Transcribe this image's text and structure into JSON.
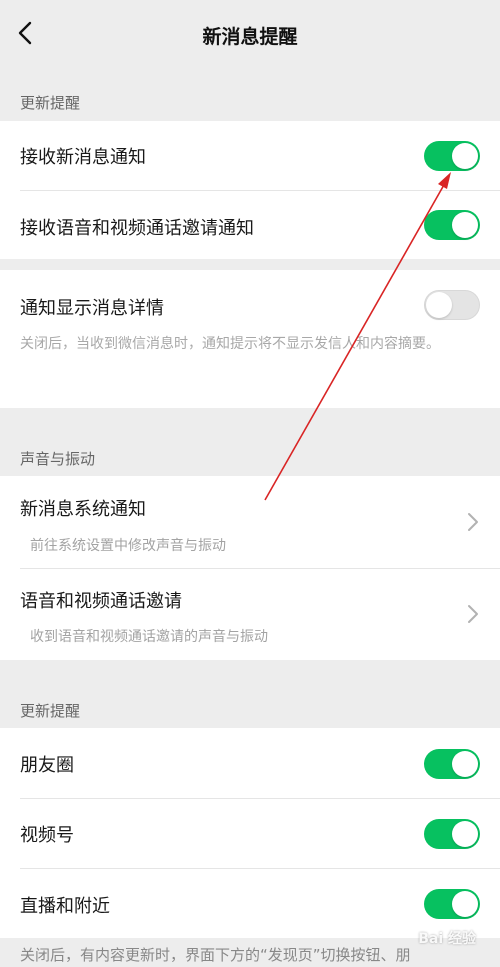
{
  "nav": {
    "title": "新消息提醒",
    "back_icon": "chevron-left-icon"
  },
  "sections": {
    "update_1": {
      "label": "更新提醒"
    },
    "sound": {
      "label": "声音与振动"
    },
    "update_2": {
      "label": "更新提醒"
    }
  },
  "rows": {
    "receive_new": {
      "title": "接收新消息通知",
      "toggle": "on"
    },
    "receive_call": {
      "title": "接收语音和视频通话邀请通知",
      "toggle": "on"
    },
    "show_detail": {
      "title": "通知显示消息详情",
      "toggle": "off",
      "desc": "关闭后，当收到微信消息时，通知提示将不显示发信人和内容摘要。"
    },
    "system_notify": {
      "title": "新消息系统通知",
      "sub": "前往系统设置中修改声音与振动"
    },
    "call_invite": {
      "title": "语音和视频通话邀请",
      "sub": "收到语音和视频通话邀请的声音与振动"
    },
    "moments": {
      "title": "朋友圈",
      "toggle": "on"
    },
    "channels": {
      "title": "视频号",
      "toggle": "on"
    },
    "live_nearby": {
      "title": "直播和附近",
      "toggle": "on"
    }
  },
  "bottom_desc": "关闭后，有内容更新时，界面下方的“发现页”切换按钮、朋",
  "watermark": "Bai 经验",
  "colors": {
    "accent_green": "#07c160",
    "annotation_red": "#d92525",
    "background": "#ededed"
  }
}
